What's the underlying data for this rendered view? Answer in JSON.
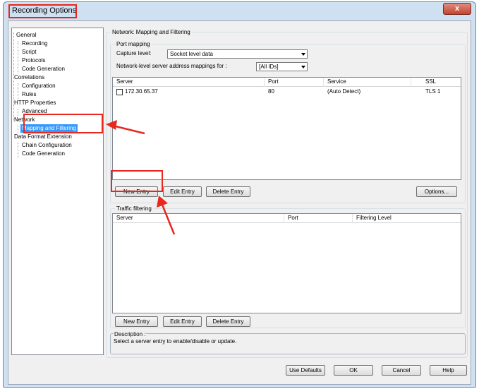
{
  "window": {
    "title": "Recording Options",
    "close_label": "x"
  },
  "tree": {
    "items": [
      {
        "label": "General",
        "level": 0
      },
      {
        "label": "Recording",
        "level": 1
      },
      {
        "label": "Script",
        "level": 1
      },
      {
        "label": "Protocols",
        "level": 1
      },
      {
        "label": "Code Generation",
        "level": 1
      },
      {
        "label": "Correlations",
        "level": 0
      },
      {
        "label": "Configuration",
        "level": 1
      },
      {
        "label": "Rules",
        "level": 1
      },
      {
        "label": "HTTP Properties",
        "level": 0
      },
      {
        "label": "Advanced",
        "level": 1
      },
      {
        "label": "Network",
        "level": 0
      },
      {
        "label": "Mapping and Filtering",
        "level": 1,
        "selected": true
      },
      {
        "label": "Data Format Extension",
        "level": 0
      },
      {
        "label": "Chain Configuration",
        "level": 1
      },
      {
        "label": "Code Generation",
        "level": 1
      }
    ]
  },
  "panel": {
    "title": "Network: Mapping and Filtering"
  },
  "port_mapping": {
    "label": "Port mapping",
    "capture_level_label": "Capture level:",
    "capture_level_value": "Socket level data",
    "server_mappings_label": "Network-level server address mappings for :",
    "server_mappings_value": "[All IDs]",
    "columns": [
      "Server",
      "Port",
      "Service",
      "SSL"
    ],
    "rows": [
      {
        "server": "172.30.65.37",
        "port": "80",
        "service": "(Auto Detect)",
        "ssl": "TLS 1",
        "checked": false
      }
    ],
    "buttons": {
      "new_entry": "New Entry",
      "edit_entry": "Edit Entry",
      "delete_entry": "Delete Entry",
      "options": "Options..."
    }
  },
  "traffic_filtering": {
    "label": "Traffic filtering",
    "columns": [
      "Server",
      "Port",
      "Filtering Level"
    ],
    "buttons": {
      "new_entry": "New Entry",
      "edit_entry": "Edit Entry",
      "delete_entry": "Delete Entry"
    }
  },
  "description": {
    "label": "Description :",
    "text": "Select a server entry to enable/disable or update."
  },
  "footer": {
    "use_defaults": "Use Defaults",
    "ok": "OK",
    "cancel": "Cancel",
    "help": "Help"
  },
  "colors": {
    "annotation_red": "#e8271e",
    "selection_blue": "#3399ff"
  }
}
